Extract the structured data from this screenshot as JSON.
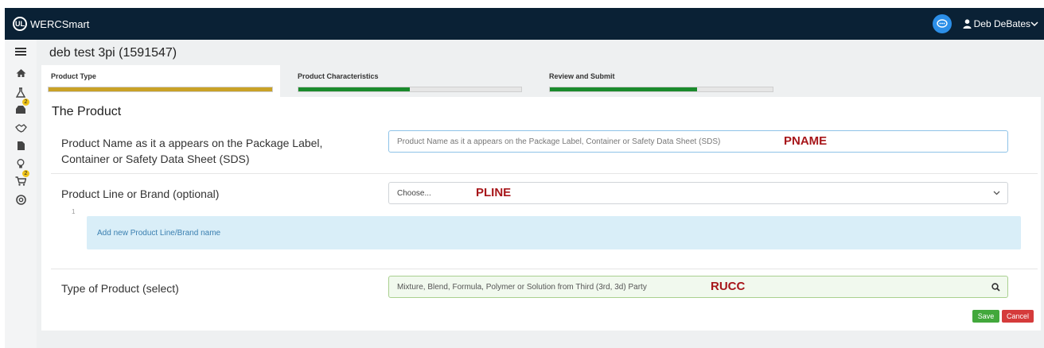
{
  "app": {
    "logo_text": "UL",
    "name": "WERCSmart"
  },
  "user": {
    "name": "Deb DeBates"
  },
  "page": {
    "title": "deb test 3pi (1591547)"
  },
  "steps": [
    {
      "label": "Product Type",
      "progress": 1.0,
      "color": "#c9a227"
    },
    {
      "label": "Product Characteristics",
      "progress": 0.5,
      "color": "#1a8a2c"
    },
    {
      "label": "Review and Submit",
      "progress": 0.66,
      "color": "#1a8a2c"
    }
  ],
  "sidebar": {
    "items": [
      {
        "icon": "home-icon"
      },
      {
        "icon": "flask-icon"
      },
      {
        "icon": "inbox-icon",
        "badge": "2"
      },
      {
        "icon": "handshake-icon"
      },
      {
        "icon": "document-icon"
      },
      {
        "icon": "lightbulb-icon"
      },
      {
        "icon": "cart-icon",
        "badge": "2"
      },
      {
        "icon": "lifebuoy-icon"
      }
    ]
  },
  "form": {
    "section_title": "The Product",
    "product_name": {
      "label": "Product Name as it a appears on the Package Label, Container or Safety Data Sheet (SDS)",
      "placeholder": "Product Name as it a appears on the Package Label, Container or Safety Data Sheet (SDS)",
      "tag": "PNAME"
    },
    "product_line": {
      "label": "Product Line or Brand (optional)",
      "value": "Choose...",
      "tag": "PLINE",
      "count": "1",
      "add_label": "Add new Product Line/Brand name"
    },
    "product_type": {
      "label": "Type of Product (select)",
      "value": "Mixture, Blend, Formula, Polymer or Solution from Third (3rd, 3d) Party",
      "tag": "RUCC"
    },
    "save_label": "Save",
    "cancel_label": "Cancel"
  }
}
